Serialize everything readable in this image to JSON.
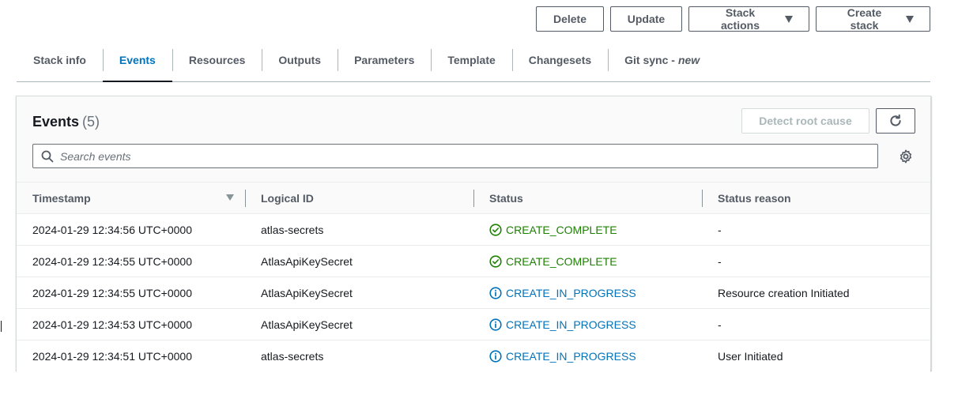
{
  "actions": {
    "delete": "Delete",
    "update": "Update",
    "stack_actions": "Stack actions",
    "create_stack": "Create stack"
  },
  "tabs": [
    {
      "label": "Stack info"
    },
    {
      "label": "Events",
      "active": true
    },
    {
      "label": "Resources"
    },
    {
      "label": "Outputs"
    },
    {
      "label": "Parameters"
    },
    {
      "label": "Template"
    },
    {
      "label": "Changesets"
    },
    {
      "label": "Git sync - ",
      "badge": "new"
    }
  ],
  "panel": {
    "title": "Events",
    "count": "(5)",
    "detect_root_cause": "Detect root cause",
    "search_placeholder": "Search events"
  },
  "table": {
    "headers": [
      "Timestamp",
      "Logical ID",
      "Status",
      "Status reason"
    ],
    "rows": [
      {
        "timestamp": "2024-01-29 12:34:56 UTC+0000",
        "logical_id": "atlas-secrets",
        "status": "CREATE_COMPLETE",
        "status_kind": "complete",
        "reason": "-"
      },
      {
        "timestamp": "2024-01-29 12:34:55 UTC+0000",
        "logical_id": "AtlasApiKeySecret",
        "status": "CREATE_COMPLETE",
        "status_kind": "complete",
        "reason": "-"
      },
      {
        "timestamp": "2024-01-29 12:34:55 UTC+0000",
        "logical_id": "AtlasApiKeySecret",
        "status": "CREATE_IN_PROGRESS",
        "status_kind": "progress",
        "reason": "Resource creation Initiated"
      },
      {
        "timestamp": "2024-01-29 12:34:53 UTC+0000",
        "logical_id": "AtlasApiKeySecret",
        "status": "CREATE_IN_PROGRESS",
        "status_kind": "progress",
        "reason": "-"
      },
      {
        "timestamp": "2024-01-29 12:34:51 UTC+0000",
        "logical_id": "atlas-secrets",
        "status": "CREATE_IN_PROGRESS",
        "status_kind": "progress",
        "reason": "User Initiated"
      }
    ]
  },
  "icons": {
    "complete": "check-circle-icon",
    "progress": "info-circle-icon"
  },
  "colors": {
    "accent": "#0073bb",
    "success": "#1d8102",
    "text": "#16191f",
    "muted": "#545b64"
  }
}
